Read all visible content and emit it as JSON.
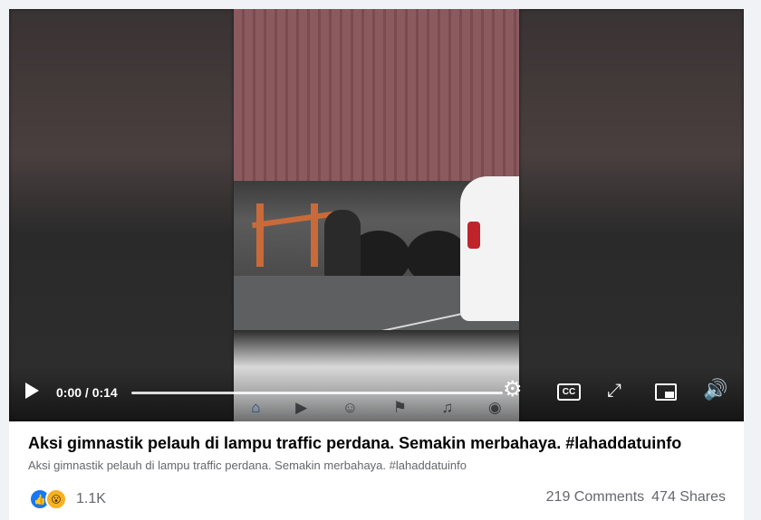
{
  "video": {
    "time_display": "0:00 / 0:14",
    "progress_fraction": 0.0,
    "controls": {
      "play_icon": "play-icon",
      "settings_icon": "gear-icon",
      "captions_label": "CC",
      "fullscreen_icon": "expand-icon",
      "pip_icon": "picture-in-picture-icon",
      "volume_icon": "volume-icon"
    },
    "phone_nav_icons": [
      "home-icon",
      "watch-icon",
      "groups-icon",
      "flag-icon",
      "bell-icon",
      "menu-icon"
    ]
  },
  "post": {
    "title": "Aksi gimnastik pelauh di lampu traffic perdana. Semakin merbahaya. #lahaddatuinfo",
    "description": "Aksi gimnastik pelauh di lampu traffic perdana. Semakin merbahaya. #lahaddatuinfo"
  },
  "engagement": {
    "reaction_icons": [
      "like-icon",
      "wow-icon"
    ],
    "reaction_count": "1.1K",
    "comments": "219 Comments",
    "shares": "474 Shares"
  },
  "colors": {
    "accent": "#1877f2",
    "text_primary": "#050505",
    "text_secondary": "#65676b"
  }
}
